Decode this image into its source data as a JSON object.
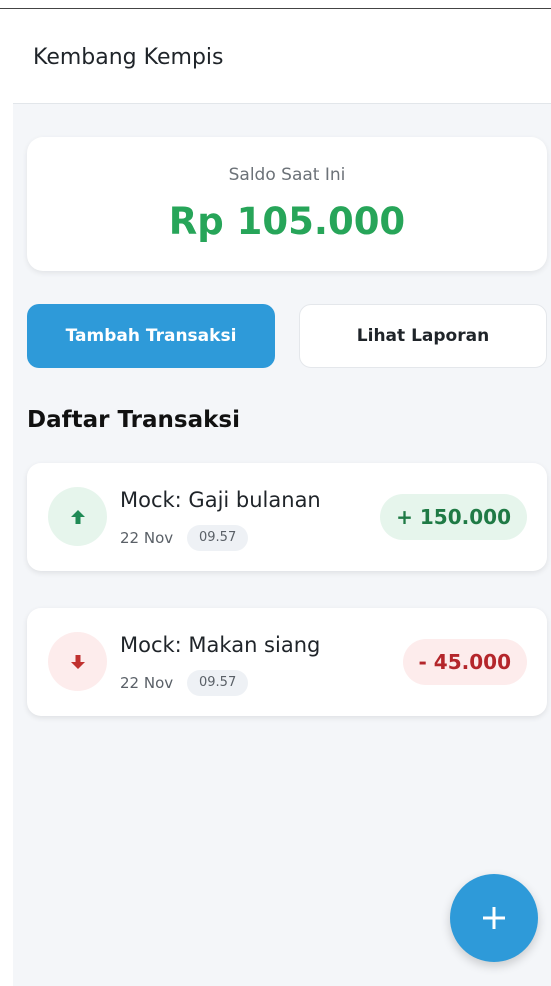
{
  "app": {
    "title": "Kembang Kempis"
  },
  "balance": {
    "label": "Saldo Saat Ini",
    "amount": "Rp 105.000",
    "color": "#27a559"
  },
  "actions": {
    "add_label": "Tambah Transaksi",
    "report_label": "Lihat Laporan"
  },
  "transactions": {
    "section_title": "Daftar Transaksi",
    "items": [
      {
        "title": "Mock: Gaji bulanan",
        "date": "22 Nov",
        "time": "09.57",
        "amount": "+ 150.000",
        "type": "income",
        "icon": "arrow-up-icon"
      },
      {
        "title": "Mock: Makan siang",
        "date": "22 Nov",
        "time": "09.57",
        "amount": "- 45.000",
        "type": "expense",
        "icon": "arrow-down-icon"
      }
    ]
  },
  "fab": {
    "icon": "plus-icon"
  },
  "colors": {
    "accent": "#2e9ad9",
    "income": "#1f7a45",
    "expense": "#b4262b"
  }
}
